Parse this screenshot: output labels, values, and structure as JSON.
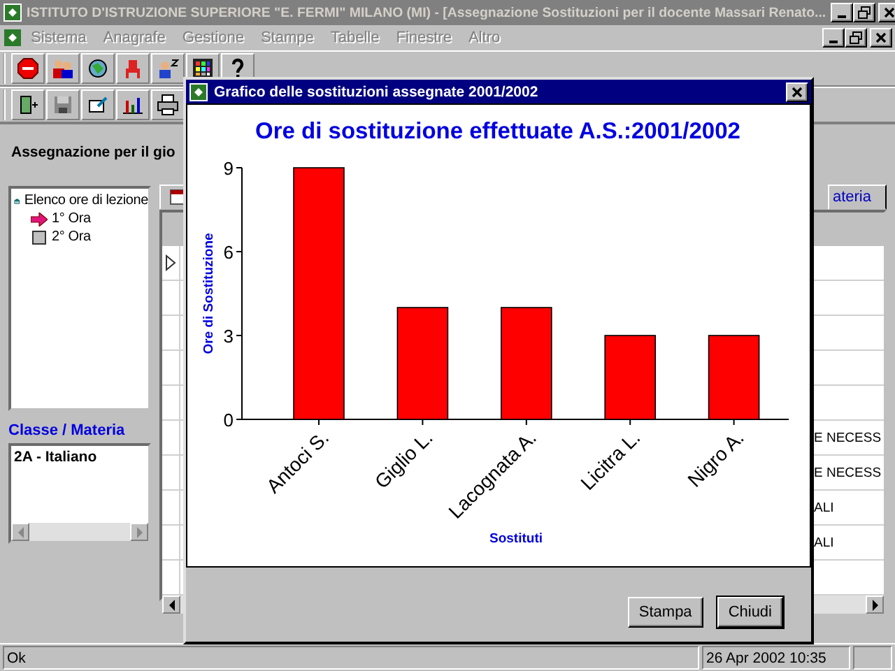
{
  "window": {
    "title": "ISTITUTO D'ISTRUZIONE SUPERIORE \"E. FERMI\" MILANO (MI) - [Assegnazione Sostituzioni per il docente Massari Renato...",
    "active": false
  },
  "menu": [
    {
      "label": "Sistema",
      "disabled": true
    },
    {
      "label": "Anagrafe",
      "disabled": true
    },
    {
      "label": "Gestione",
      "disabled": true
    },
    {
      "label": "Stampe",
      "disabled": true
    },
    {
      "label": "Tabelle",
      "disabled": true
    },
    {
      "label": "Finestre",
      "disabled": true
    },
    {
      "label": "Altro",
      "disabled": true
    }
  ],
  "page": {
    "heading": "Assegnazione per il gio"
  },
  "tree": {
    "label": "Elenco ore di lezione",
    "children": [
      {
        "label": "1° Ora",
        "selected": true
      },
      {
        "label": "2° Ora",
        "selected": false
      }
    ]
  },
  "class_list": {
    "title": "Classe / Materia",
    "items": [
      "2A - Italiano"
    ]
  },
  "grid": {
    "tab": "ateria",
    "rows": [
      "E NECESS",
      "E NECESS",
      "ALI",
      "ALI"
    ]
  },
  "dialog": {
    "title": "Grafico delle sostituzioni assegnate 2001/2002",
    "chart_data": {
      "type": "bar",
      "title": "Ore di sostituzione effettuate A.S.:2001/2002",
      "xlabel": "Sostituti",
      "ylabel": "Ore di Sostituzione",
      "categories": [
        "Antoci S.",
        "Giglio L.",
        "Lacognata A.",
        "Licitra  L.",
        "Nigro A."
      ],
      "values": [
        9,
        4,
        4,
        3,
        3
      ],
      "ylim": [
        0,
        9
      ],
      "yticks": [
        0,
        3,
        6,
        9
      ]
    },
    "buttons": [
      {
        "label": "Stampa",
        "default": false
      },
      {
        "label": "Chiudi",
        "default": true
      }
    ]
  },
  "status_bar": {
    "message": "Ok",
    "datetime": "26 Apr 2002 10:35"
  }
}
